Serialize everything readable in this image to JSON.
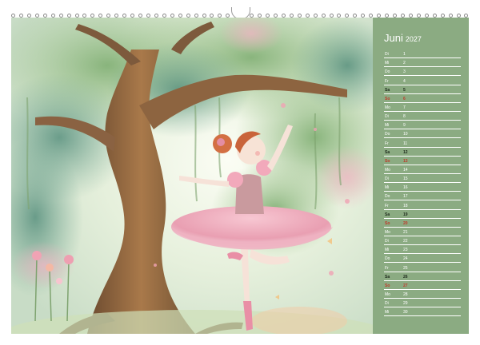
{
  "calendar": {
    "month": "Juni",
    "year": "2027",
    "days": [
      {
        "wd": "Di",
        "d": "1",
        "type": "weekday"
      },
      {
        "wd": "Mi",
        "d": "2",
        "type": "weekday"
      },
      {
        "wd": "Do",
        "d": "3",
        "type": "weekday"
      },
      {
        "wd": "Fr",
        "d": "4",
        "type": "weekday"
      },
      {
        "wd": "Sa",
        "d": "5",
        "type": "sat"
      },
      {
        "wd": "So",
        "d": "6",
        "type": "sun"
      },
      {
        "wd": "Mo",
        "d": "7",
        "type": "weekday"
      },
      {
        "wd": "Di",
        "d": "8",
        "type": "weekday"
      },
      {
        "wd": "Mi",
        "d": "9",
        "type": "weekday"
      },
      {
        "wd": "Do",
        "d": "10",
        "type": "weekday"
      },
      {
        "wd": "Fr",
        "d": "11",
        "type": "weekday"
      },
      {
        "wd": "Sa",
        "d": "12",
        "type": "sat"
      },
      {
        "wd": "So",
        "d": "13",
        "type": "sun"
      },
      {
        "wd": "Mo",
        "d": "14",
        "type": "weekday"
      },
      {
        "wd": "Di",
        "d": "15",
        "type": "weekday"
      },
      {
        "wd": "Mi",
        "d": "16",
        "type": "weekday"
      },
      {
        "wd": "Do",
        "d": "17",
        "type": "weekday"
      },
      {
        "wd": "Fr",
        "d": "18",
        "type": "weekday"
      },
      {
        "wd": "Sa",
        "d": "19",
        "type": "sat"
      },
      {
        "wd": "So",
        "d": "20",
        "type": "sun"
      },
      {
        "wd": "Mo",
        "d": "21",
        "type": "weekday"
      },
      {
        "wd": "Di",
        "d": "22",
        "type": "weekday"
      },
      {
        "wd": "Mi",
        "d": "23",
        "type": "weekday"
      },
      {
        "wd": "Do",
        "d": "24",
        "type": "weekday"
      },
      {
        "wd": "Fr",
        "d": "25",
        "type": "weekday"
      },
      {
        "wd": "Sa",
        "d": "26",
        "type": "sat"
      },
      {
        "wd": "So",
        "d": "27",
        "type": "sun"
      },
      {
        "wd": "Mo",
        "d": "28",
        "type": "weekday"
      },
      {
        "wd": "Di",
        "d": "29",
        "type": "weekday"
      },
      {
        "wd": "Mi",
        "d": "30",
        "type": "weekday"
      }
    ]
  },
  "colors": {
    "panel": "#8bab82",
    "sunday": "#c0392b",
    "saturday": "#1e2a1c"
  },
  "illustration": {
    "icon": "ballerina-under-tree-illustration"
  }
}
